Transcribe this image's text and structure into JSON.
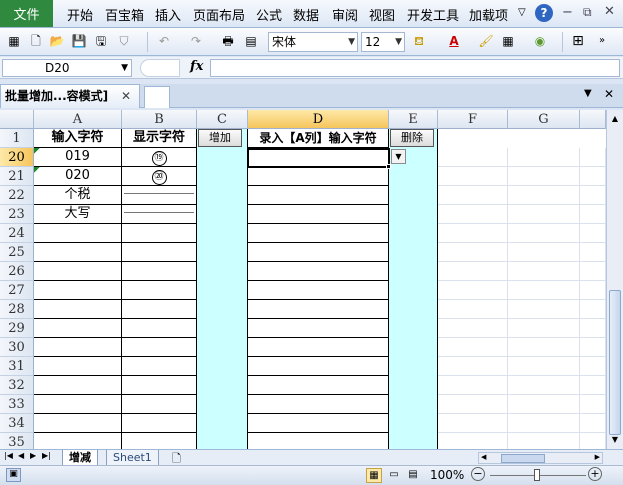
{
  "ribbon": {
    "file": "文件",
    "tabs": [
      "开始",
      "百宝箱",
      "插入",
      "页面布局",
      "公式",
      "数据",
      "审阅",
      "视图",
      "开发工具",
      "加载项"
    ]
  },
  "toolbar": {
    "font": "宋体",
    "size": "12"
  },
  "formula_bar": {
    "name_box": "D20",
    "fx": "fx",
    "content": ""
  },
  "doc_tab": {
    "title": "批量增加...容模式]",
    "close": "✕"
  },
  "columns": [
    "A",
    "B",
    "C",
    "D",
    "E",
    "F",
    "G"
  ],
  "header_row": {
    "row": "1",
    "a": "输入字符",
    "b": "显示字符",
    "c": "增加",
    "d": "录入【A列】输入字符",
    "e": "删除"
  },
  "rows": [
    {
      "n": "20",
      "a": "019",
      "b": "⑲"
    },
    {
      "n": "21",
      "a": "020",
      "b": "⑳"
    },
    {
      "n": "22",
      "a": "个税",
      "b": ""
    },
    {
      "n": "23",
      "a": "大写",
      "b": ""
    },
    {
      "n": "24"
    },
    {
      "n": "25"
    },
    {
      "n": "26"
    },
    {
      "n": "27"
    },
    {
      "n": "28"
    },
    {
      "n": "29"
    },
    {
      "n": "30"
    },
    {
      "n": "31"
    },
    {
      "n": "32"
    },
    {
      "n": "33"
    },
    {
      "n": "34"
    },
    {
      "n": "35"
    }
  ],
  "sheets": [
    "增减",
    "Sheet1"
  ],
  "status": {
    "zoom": "100%"
  },
  "colors": {
    "file_tab": "#2f8a3f",
    "cyan_fill": "#ccffff",
    "selected_header": "#f6c55c"
  },
  "icons": [
    "help-icon",
    "minimize-icon",
    "restore-icon",
    "close-icon",
    "function-icon",
    "new-sheet-icon",
    "zoom-out-icon",
    "zoom-in-icon"
  ]
}
